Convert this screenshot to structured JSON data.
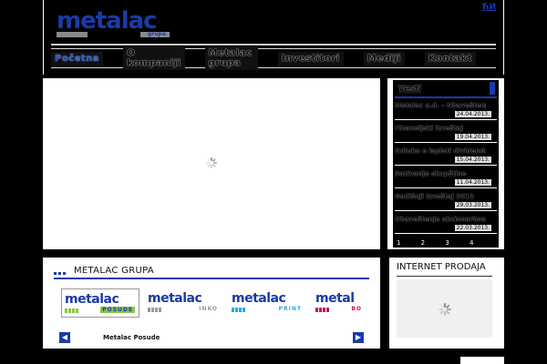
{
  "header": {
    "logo_text": "metalac",
    "logo_sub": "grupa",
    "language": "ЋИ"
  },
  "nav": {
    "items": [
      {
        "label": "Početna"
      },
      {
        "label": "O kompaniji"
      },
      {
        "label": "Metalac grupa"
      },
      {
        "label": "Investitori"
      },
      {
        "label": "Mediji"
      },
      {
        "label": "Kontakt"
      }
    ]
  },
  "news": {
    "title": "Vesti",
    "items": [
      {
        "title": "Metalac a.d. – Obaveštenje",
        "date": "24.04.2013."
      },
      {
        "title": "Finansijski izveštaj",
        "date": "19.04.2013."
      },
      {
        "title": "Odluka o isplati dividende",
        "date": "15.04.2013."
      },
      {
        "title": "Sazivanje skupštine",
        "date": "11.04.2013."
      },
      {
        "title": "Godišnji izveštaj 2012",
        "date": "29.03.2013."
      },
      {
        "title": "Obaveštenje akcionarima",
        "date": "22.03.2013."
      }
    ],
    "pager": "1 2 3 4"
  },
  "grupa": {
    "title": "METALAC GRUPA",
    "caption": "Metalac Posude",
    "brands": [
      {
        "word": "metalac",
        "sub": "POSUDE",
        "sub_bg": "#8bc34a",
        "sub_color": "#1a3aa8",
        "squares": [
          "#8bc34a",
          "#8bc34a",
          "#8bc34a",
          "#8bc34a"
        ]
      },
      {
        "word": "metalac",
        "sub": "INKO",
        "sub_bg": "#ffffff",
        "sub_color": "#9a9a9a",
        "squares": [
          "#9a9a9a",
          "#9a9a9a",
          "#9a9a9a",
          "#9a9a9a"
        ]
      },
      {
        "word": "metalac",
        "sub": "PRINT",
        "sub_bg": "#ffffff",
        "sub_color": "#29a8e0",
        "squares": [
          "#29a8e0",
          "#29a8e0",
          "#29a8e0",
          "#29a8e0"
        ]
      },
      {
        "word": "metal",
        "sub": "BO",
        "sub_bg": "#ffffff",
        "sub_color": "#c2185b",
        "squares": [
          "#c2185b",
          "#c2185b",
          "#c2185b",
          "#c2185b"
        ]
      }
    ],
    "prev_icon": "chevron-left-icon",
    "next_icon": "chevron-right-icon"
  },
  "prodaja": {
    "title": "INTERNET PRODAJA"
  },
  "colors": {
    "brand_blue": "#1a3aa8",
    "background": "#000000",
    "panel": "#ffffff"
  }
}
